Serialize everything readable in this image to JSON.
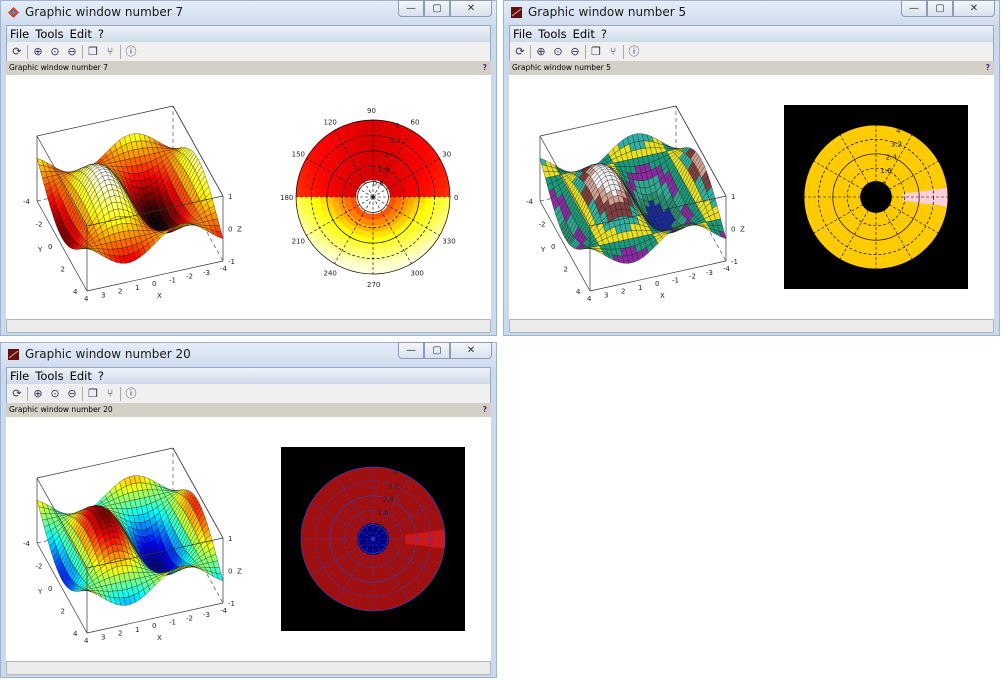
{
  "windows": [
    {
      "title": "Graphic window number 7",
      "info_label": "Graphic window number 7",
      "info_help": "?",
      "colormap": "hot",
      "polar_style": "hot-white-bg",
      "icon": "scilab-colorful-icon"
    },
    {
      "title": "Graphic window number 5",
      "info_label": "Graphic window number 5",
      "info_help": "?",
      "colormap": "banded",
      "polar_style": "yellow-black-bg",
      "icon": "scilab-graphic-icon"
    },
    {
      "title": "Graphic window number 20",
      "info_label": "Graphic window number 20",
      "info_help": "?",
      "colormap": "jet",
      "polar_style": "darkred-black-bg",
      "icon": "scilab-graphic-icon"
    }
  ],
  "menu": [
    "File",
    "Tools",
    "Edit",
    "?"
  ],
  "window_buttons": {
    "minimize": "—",
    "maximize": "▢",
    "close": "✕"
  },
  "toolbar_icons": [
    "rotate-icon",
    "zoom-in-icon",
    "zoom-original-icon",
    "zoom-out-icon",
    "datatips-icon",
    "datatips-editor-icon",
    "help-icon"
  ],
  "surface_axes": {
    "x_label": "X",
    "y_label": "Y",
    "z_label": "Z",
    "x_ticks": [
      "4",
      "3",
      "2",
      "1",
      "0",
      "-1",
      "-2",
      "-3",
      "-4"
    ],
    "y_ticks": [
      "-4",
      "-2",
      "0",
      "2",
      "4"
    ],
    "z_ticks": [
      "1",
      "0",
      "-1"
    ]
  },
  "polar_axes": {
    "angle_ticks": [
      "0",
      "30",
      "60",
      "90",
      "120",
      "150",
      "180",
      "210",
      "240",
      "270",
      "300",
      "330"
    ],
    "radius_ticks": [
      "0.8",
      "1.6",
      "2.4",
      "3.2",
      "4"
    ]
  },
  "colors": {
    "titlebar": "#dbe6f3",
    "infobar": "#d4d0c8",
    "polar_yellow": "#ffcc00",
    "polar_darkred": "#a01010",
    "polar_hole_navy": "#000080",
    "polar_pink": "#ffd0d8"
  }
}
